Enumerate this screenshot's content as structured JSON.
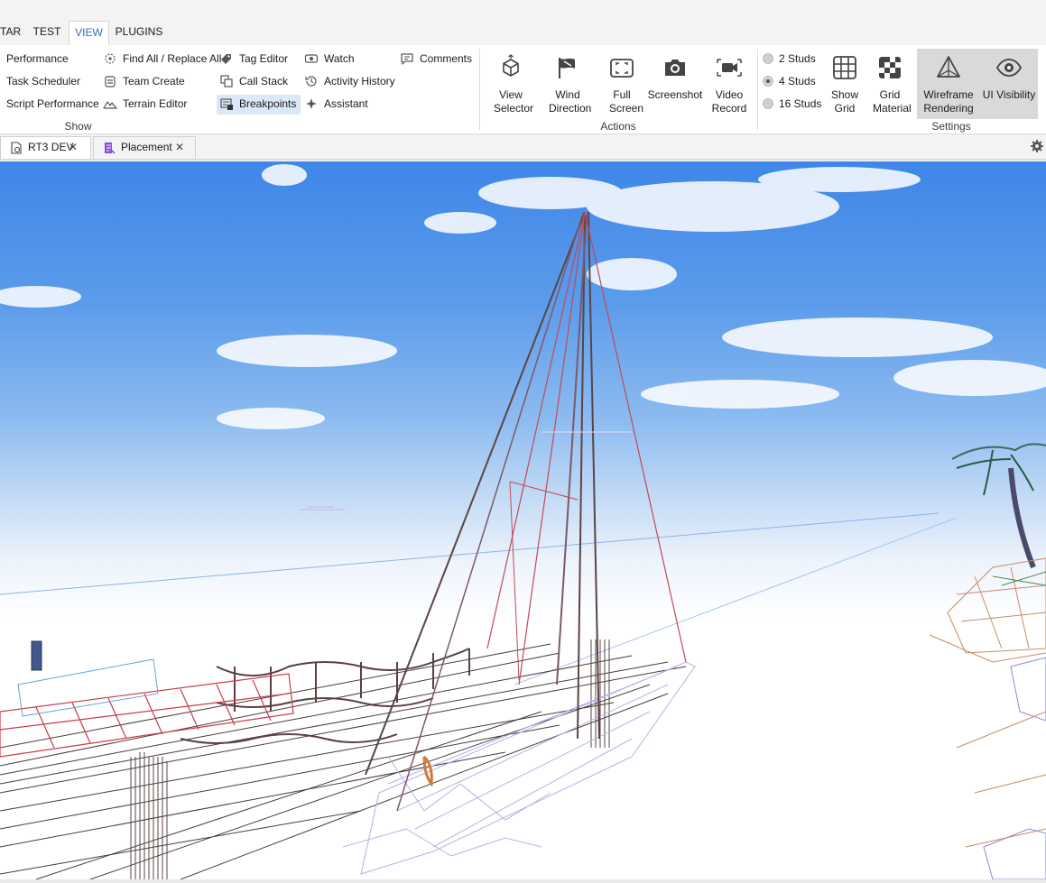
{
  "menu": {
    "tabs": [
      {
        "label": "TAR"
      },
      {
        "label": "TEST"
      },
      {
        "label": "VIEW",
        "active": true
      },
      {
        "label": "PLUGINS"
      }
    ]
  },
  "ribbon": {
    "show": {
      "label": "Show",
      "col1": [
        "Performance",
        "Task Scheduler",
        "Script Performance"
      ],
      "col2": [
        "Find All / Replace All",
        "Team Create",
        "Terrain Editor"
      ],
      "col3": [
        "Tag Editor",
        "Call Stack",
        "Breakpoints"
      ],
      "col4": [
        "Watch",
        "Activity History",
        "Assistant"
      ],
      "col5": [
        "Comments"
      ]
    },
    "actions": {
      "label": "Actions",
      "view_selector": "View Selector",
      "wind_direction": "Wind Direction",
      "full_screen": "Full Screen",
      "screenshot": "Screenshot",
      "video_record": "Video Record"
    },
    "settings": {
      "label": "Settings",
      "studs": [
        {
          "label": "2 Studs",
          "selected": false
        },
        {
          "label": "4 Studs",
          "selected": true
        },
        {
          "label": "16 Studs",
          "selected": false
        }
      ],
      "show_grid": "Show Grid",
      "grid_material": "Grid Material",
      "wireframe_rendering": "Wireframe Rendering",
      "ui_visibility": "UI Visibility"
    }
  },
  "doc_tabs": [
    {
      "label": "RT3 DEV",
      "active": true
    },
    {
      "label": "Placement",
      "active": false
    }
  ],
  "colors": {
    "accent": "#2d6fc4",
    "selected_bg": "#dbe8f7",
    "toggle_on_bg": "#d9d9d9"
  }
}
